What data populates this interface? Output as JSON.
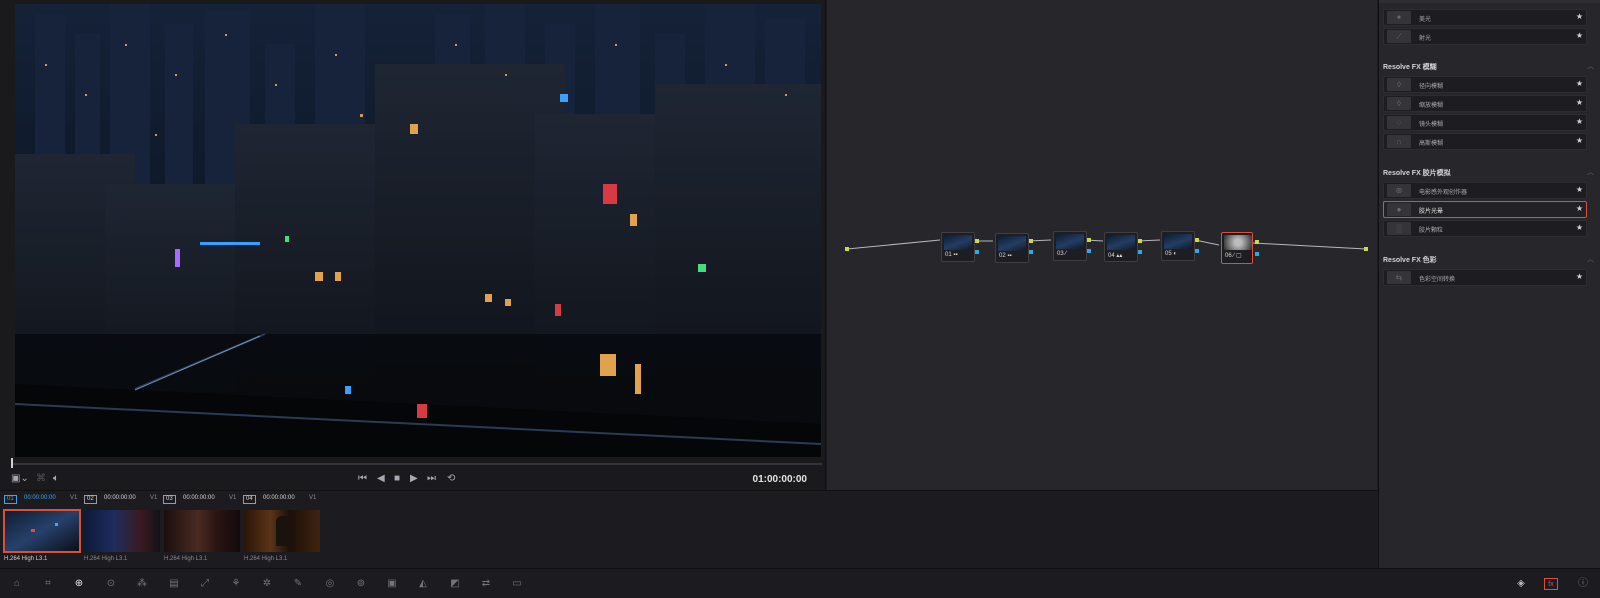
{
  "viewer": {
    "timecode": "01:00:00:00"
  },
  "nodes": [
    {
      "label": "01 ▪▪"
    },
    {
      "label": "02 ▪▪"
    },
    {
      "label": "03 ⁄"
    },
    {
      "label": "04 ▴▴"
    },
    {
      "label": "05 ◐"
    },
    {
      "label": "06 ⁄ ▢"
    }
  ],
  "fx_library": {
    "top_items": [
      {
        "name": "美光",
        "icon": "bloom-icon"
      },
      {
        "name": "射光",
        "icon": "ray-icon"
      }
    ],
    "sections": [
      {
        "title": "Resolve FX 模糊",
        "items": [
          {
            "name": "径向模糊",
            "icon": "drop-icon"
          },
          {
            "name": "缩放模糊",
            "icon": "drop-icon"
          },
          {
            "name": "镜头模糊",
            "icon": "lens-blur-icon"
          },
          {
            "name": "高斯模糊",
            "icon": "gaussian-icon"
          }
        ]
      },
      {
        "title": "Resolve FX 胶片模拟",
        "items": [
          {
            "name": "电影感外观创作器",
            "icon": "film-look-icon"
          },
          {
            "name": "胶片光晕",
            "icon": "halation-icon",
            "selected": true
          },
          {
            "name": "胶片颗粒",
            "icon": "grain-icon"
          }
        ]
      },
      {
        "title": "Resolve FX 色彩",
        "items": [
          {
            "name": "色彩空间转换",
            "icon": "color-space-icon"
          }
        ]
      }
    ]
  },
  "clips": [
    {
      "num": "01",
      "tc": "00:00:00:00",
      "track": "V1",
      "codec": "H.264 High L3.1",
      "active": true
    },
    {
      "num": "02",
      "tc": "00:00:00:00",
      "track": "V1",
      "codec": "H.264 High L3.1"
    },
    {
      "num": "03",
      "tc": "00:00:00:00",
      "track": "V1",
      "codec": "H.264 High L3.1"
    },
    {
      "num": "04",
      "tc": "00:00:00:00",
      "track": "V1",
      "codec": "H.264 High L3.1"
    }
  ],
  "colors": {
    "accent_selection": "#d9503f",
    "accent_active": "#3fa3e6",
    "port_green": "#cfd84a",
    "port_blue": "#2fa8e8"
  }
}
